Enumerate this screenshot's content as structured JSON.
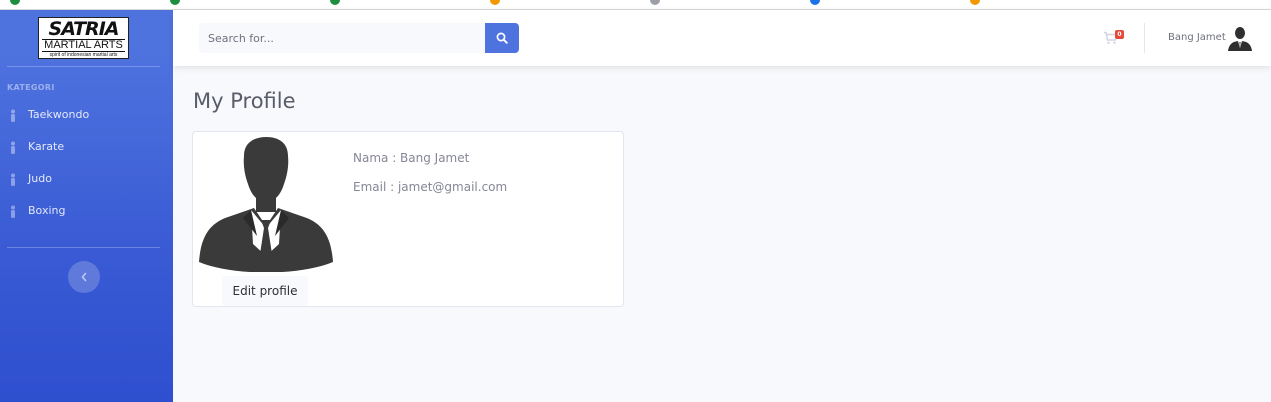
{
  "brand": {
    "line1": "SATRIA",
    "line2": "MARTIAL ARTS",
    "line3": "spirit of indonesian martial arts"
  },
  "sidebar": {
    "heading": "KATEGORI",
    "items": [
      {
        "label": "Taekwondo",
        "icon": "person-icon"
      },
      {
        "label": "Karate",
        "icon": "person-icon"
      },
      {
        "label": "Judo",
        "icon": "person-icon"
      },
      {
        "label": "Boxing",
        "icon": "person-icon"
      }
    ],
    "toggle_icon": "chevron-left-icon"
  },
  "topbar": {
    "search_placeholder": "Search for...",
    "search_icon": "search-icon",
    "cart_icon": "cart-icon",
    "cart_count": "0",
    "user_name": "Bang Jamet",
    "avatar_icon": "user-silhouette-icon"
  },
  "main": {
    "title": "My Profile",
    "profile": {
      "nama": "Nama : Bang Jamet",
      "email": "Email : jamet@gmail.com",
      "edit_label": "Edit profile"
    }
  },
  "colors": {
    "primary": "#4e73df",
    "sidebar_bottom": "#2e4fcf",
    "badge": "#e74a3b",
    "text_muted": "#858796",
    "title": "#5a5c69"
  }
}
